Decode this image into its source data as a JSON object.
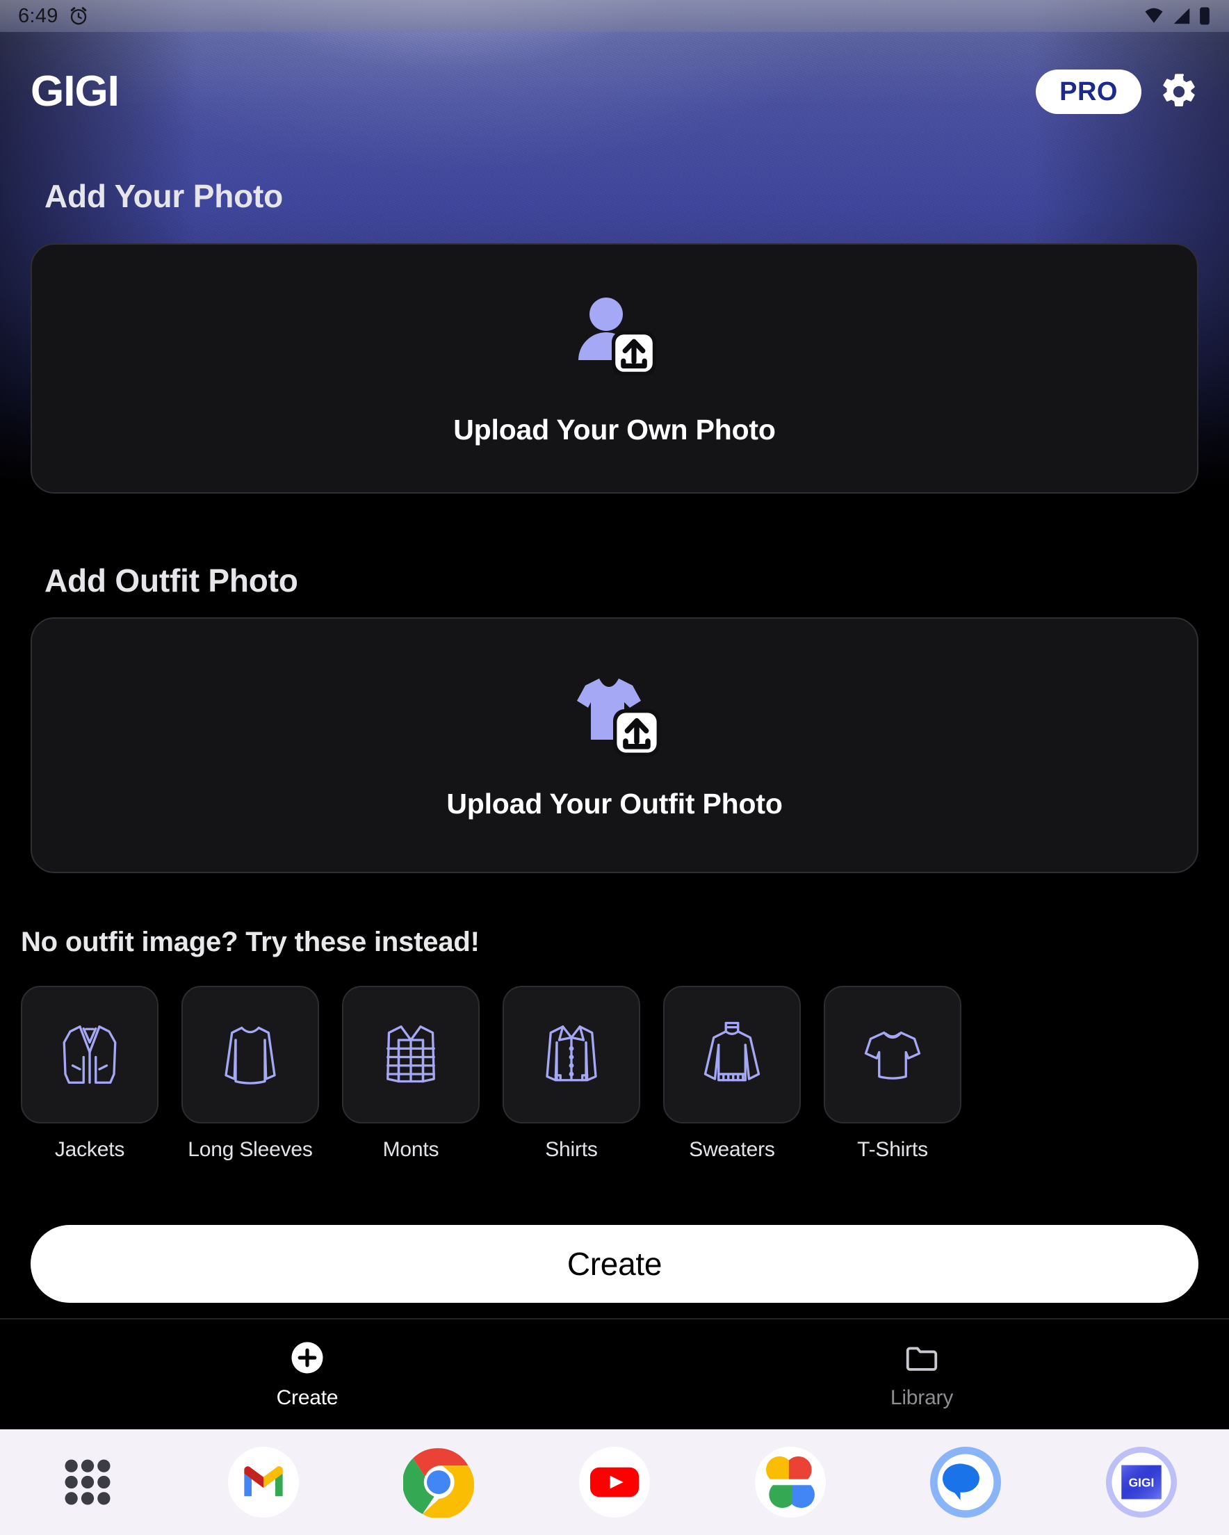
{
  "statusbar": {
    "time": "6:49",
    "icons": [
      "alarm-icon",
      "wifi-icon",
      "cellular-signal-icon",
      "battery-icon"
    ]
  },
  "header": {
    "brand": "GIGI",
    "pro_label": "PRO",
    "settings_icon": "gear-icon",
    "pro_text_color": "#1b2a8c",
    "pro_bg_color": "#ffffff"
  },
  "sections": {
    "your_photo_title": "Add Your Photo",
    "outfit_photo_title": "Add Outfit Photo",
    "upload_own_label": "Upload Your Own Photo",
    "upload_outfit_label": "Upload Your Outfit Photo",
    "your_photo_icon": "person-upload-icon",
    "outfit_photo_icon": "tshirt-upload-icon",
    "accent_color": "#a5a8f5"
  },
  "suggestions": {
    "heading": "No outfit image? Try these instead!",
    "items": [
      {
        "label": "Jackets",
        "icon": "blazer-icon"
      },
      {
        "label": "Long Sleeves",
        "icon": "long-sleeve-icon"
      },
      {
        "label": "Monts",
        "icon": "puffer-vest-icon"
      },
      {
        "label": "Shirts",
        "icon": "button-shirt-icon"
      },
      {
        "label": "Sweaters",
        "icon": "turtleneck-sweater-icon"
      },
      {
        "label": "T-Shirts",
        "icon": "tshirt-icon"
      }
    ]
  },
  "primary_action": {
    "label": "Create"
  },
  "bottom_nav": {
    "items": [
      {
        "label": "Create",
        "icon": "plus-circle-icon",
        "active": true
      },
      {
        "label": "Library",
        "icon": "folder-icon",
        "active": false
      }
    ]
  },
  "dock": {
    "apps": [
      {
        "name": "app-drawer-icon"
      },
      {
        "name": "gmail-icon"
      },
      {
        "name": "chrome-icon"
      },
      {
        "name": "youtube-icon"
      },
      {
        "name": "google-photos-icon"
      },
      {
        "name": "messages-icon"
      },
      {
        "name": "gigi-app-icon",
        "label": "GIGI"
      }
    ]
  }
}
